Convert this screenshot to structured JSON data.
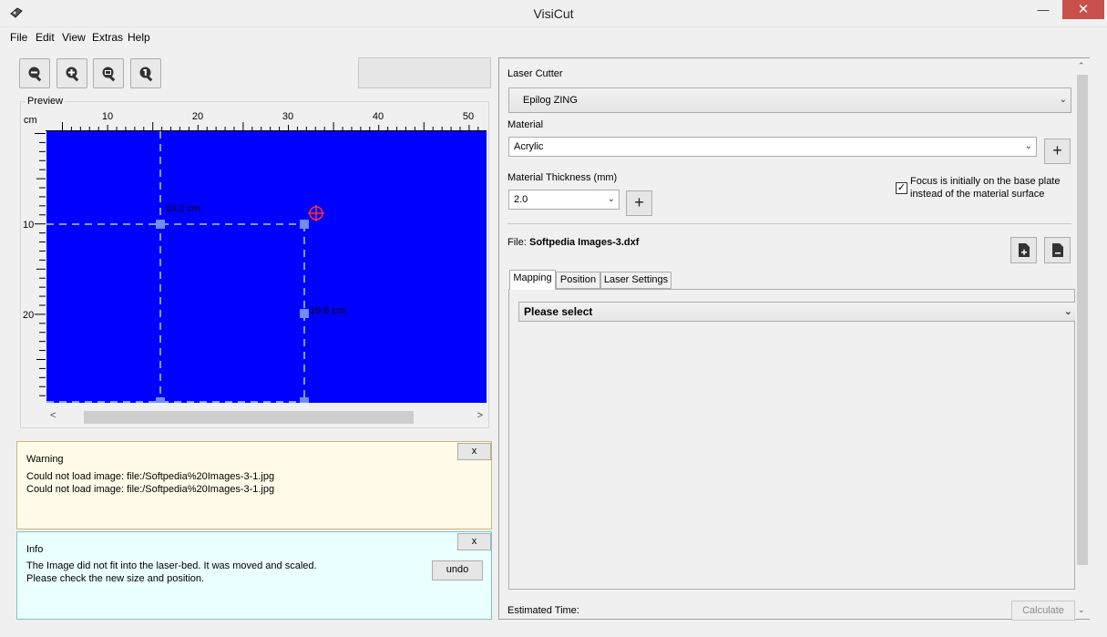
{
  "window": {
    "title": "VisiCut"
  },
  "menu": [
    "File",
    "Edit",
    "View",
    "Extras",
    "Help"
  ],
  "preview": {
    "label": "Preview",
    "unit": "cm",
    "hruler_ticks": [
      "10",
      "20",
      "30",
      "40",
      "50"
    ],
    "vruler_ticks": [
      "10",
      "20"
    ],
    "width_label": "10,2 cm",
    "height_label": "19,8 cm"
  },
  "warning": {
    "title": "Warning",
    "close": "x",
    "lines": [
      "Could not load image: file:/Softpedia%20Images-3-1.jpg",
      "Could not load image: file:/Softpedia%20Images-3-1.jpg"
    ]
  },
  "info": {
    "title": "Info",
    "close": "x",
    "lines": [
      "The Image did not fit into the laser-bed. It was moved and scaled.",
      "Please check the new size and position."
    ],
    "undo": "undo"
  },
  "settings": {
    "laser_cutter_label": "Laser Cutter",
    "laser_cutter_value": "Epilog ZING",
    "material_label": "Material",
    "material_value": "Acrylic",
    "add_label": "+",
    "thickness_label": "Material Thickness (mm)",
    "thickness_value": "2.0",
    "focus_checkbox": "✓",
    "focus_text_1": "Focus is initially on the base plate",
    "focus_text_2": "instead of the material surface",
    "file_prefix": "File:",
    "file_name": "Softpedia Images-3.dxf",
    "tabs": [
      "Mapping",
      "Position",
      "Laser Settings"
    ],
    "mapping_select": "Please select",
    "estimated_time_label": "Estimated Time:",
    "calculate": "Calculate"
  }
}
